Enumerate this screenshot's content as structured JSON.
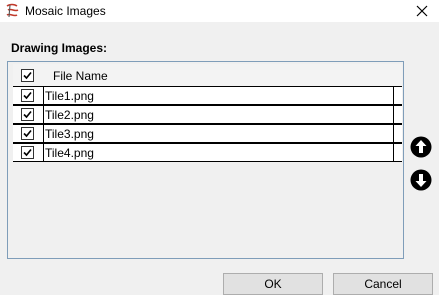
{
  "window": {
    "title": "Mosaic Images"
  },
  "section": {
    "label": "Drawing Images:"
  },
  "grid": {
    "header": {
      "name_column": "File Name",
      "all_checked": true
    },
    "rows": [
      {
        "checked": true,
        "name": "Tile1.png"
      },
      {
        "checked": true,
        "name": "Tile2.png"
      },
      {
        "checked": true,
        "name": "Tile3.png"
      },
      {
        "checked": true,
        "name": "Tile4.png"
      }
    ]
  },
  "buttons": {
    "ok": "OK",
    "cancel": "Cancel"
  },
  "icons": {
    "app": "mosaic-app-icon",
    "close": "close-icon",
    "move_up": "arrow-up-circle-icon",
    "move_down": "arrow-down-circle-icon"
  },
  "colors": {
    "accent": "#c0392b",
    "grid_border": "#7f9db9"
  }
}
